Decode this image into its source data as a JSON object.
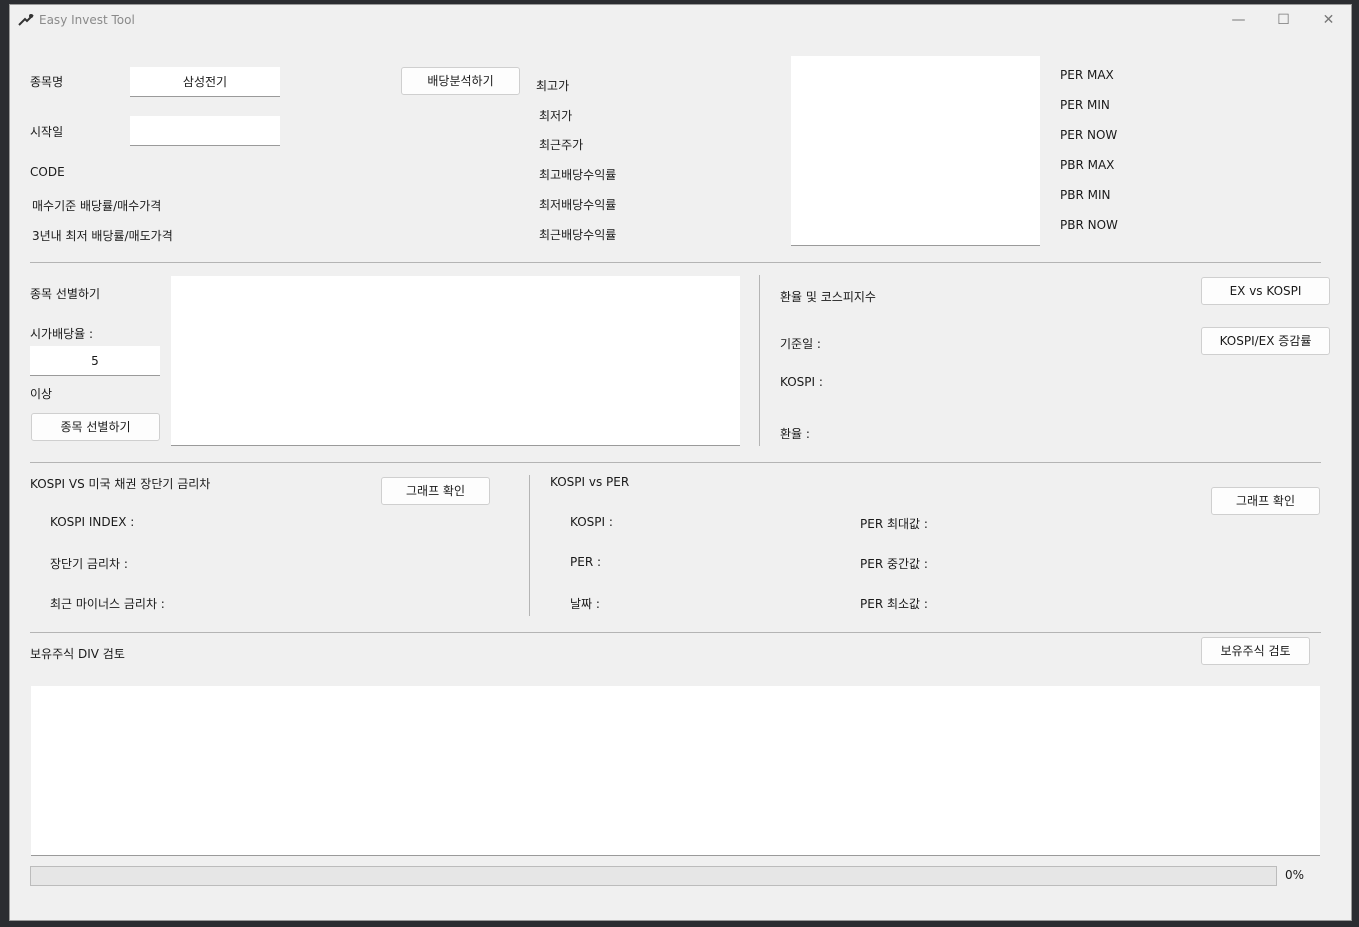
{
  "window": {
    "title": "Easy Invest Tool",
    "controls": {
      "minimize": "—",
      "maximize": "☐",
      "close": "✕"
    }
  },
  "top": {
    "stock_name_label": "종목명",
    "stock_name_value": "삼성전기",
    "start_date_label": "시작일",
    "start_date_value": "",
    "code_label": "CODE",
    "buy_dividend_label": "매수기준 배당률/매수가격",
    "sell_dividend_label": "3년내 최저 배당률/매도가격",
    "analyze_button": "배당분석하기",
    "price_labels": [
      "최고가",
      "최저가",
      "최근주가",
      "최고배당수익률",
      "최저배당수익률",
      "최근배당수익률"
    ],
    "per_labels": [
      "PER MAX",
      "PER MIN",
      "PER NOW",
      "PBR MAX",
      "PBR MIN",
      "PBR NOW"
    ]
  },
  "screener": {
    "title": "종목 선별하기",
    "yield_label": "시가배당율 :",
    "yield_value": "5",
    "above_label": "이상",
    "button": "종목 선별하기"
  },
  "exchange": {
    "title": "환율 및 코스피지수",
    "date_label": "기준일 :",
    "kospi_label": "KOSPI :",
    "rate_label": "환율 :",
    "ex_vs_kospi_button": "EX vs KOSPI",
    "ratio_button": "KOSPI/EX 증감률"
  },
  "bond": {
    "title": "KOSPI VS 미국 채권 장단기 금리차",
    "graph_button": "그래프 확인",
    "index_label": "KOSPI INDEX :",
    "spread_label": "장단기 금리차 :",
    "neg_spread_label": "최근 마이너스 금리차 :"
  },
  "kospi_per": {
    "title": "KOSPI vs PER",
    "graph_button": "그래프 확인",
    "kospi_label": "KOSPI :",
    "per_label": "PER :",
    "date_label": "날짜 :",
    "per_max_label": "PER 최대값 :",
    "per_mid_label": "PER 중간값 :",
    "per_min_label": "PER 최소값 :"
  },
  "holdings": {
    "title": "보유주식 DIV 검토",
    "button": "보유주식 검토"
  },
  "progress": {
    "value": 0,
    "label": "0%"
  }
}
